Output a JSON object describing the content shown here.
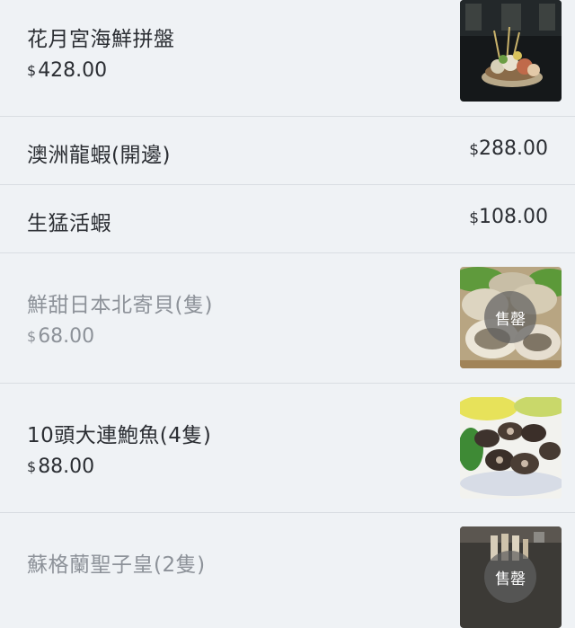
{
  "currency_symbol": "$",
  "items": [
    {
      "name": "花月宮海鮮拼盤",
      "price": "428.00",
      "has_image": true,
      "sold_out": false
    },
    {
      "name": "澳洲龍蝦(開邊)",
      "price": "288.00",
      "has_image": false,
      "sold_out": false
    },
    {
      "name": "生猛活蝦",
      "price": "108.00",
      "has_image": false,
      "sold_out": false
    },
    {
      "name": "鮮甜日本北寄貝(隻)",
      "price": "68.00",
      "has_image": true,
      "sold_out": true,
      "badge": "售罄"
    },
    {
      "name": "10頭大連鮑魚(4隻)",
      "price": "88.00",
      "has_image": true,
      "sold_out": false
    },
    {
      "name": "蘇格蘭聖子皇(2隻)",
      "price": "",
      "has_image": true,
      "sold_out": true,
      "badge": "售罄"
    }
  ],
  "colors": {
    "background": "#eff2f5",
    "text": "#2b2e33",
    "muted_text": "#8d9299",
    "divider": "#d9dde2"
  }
}
